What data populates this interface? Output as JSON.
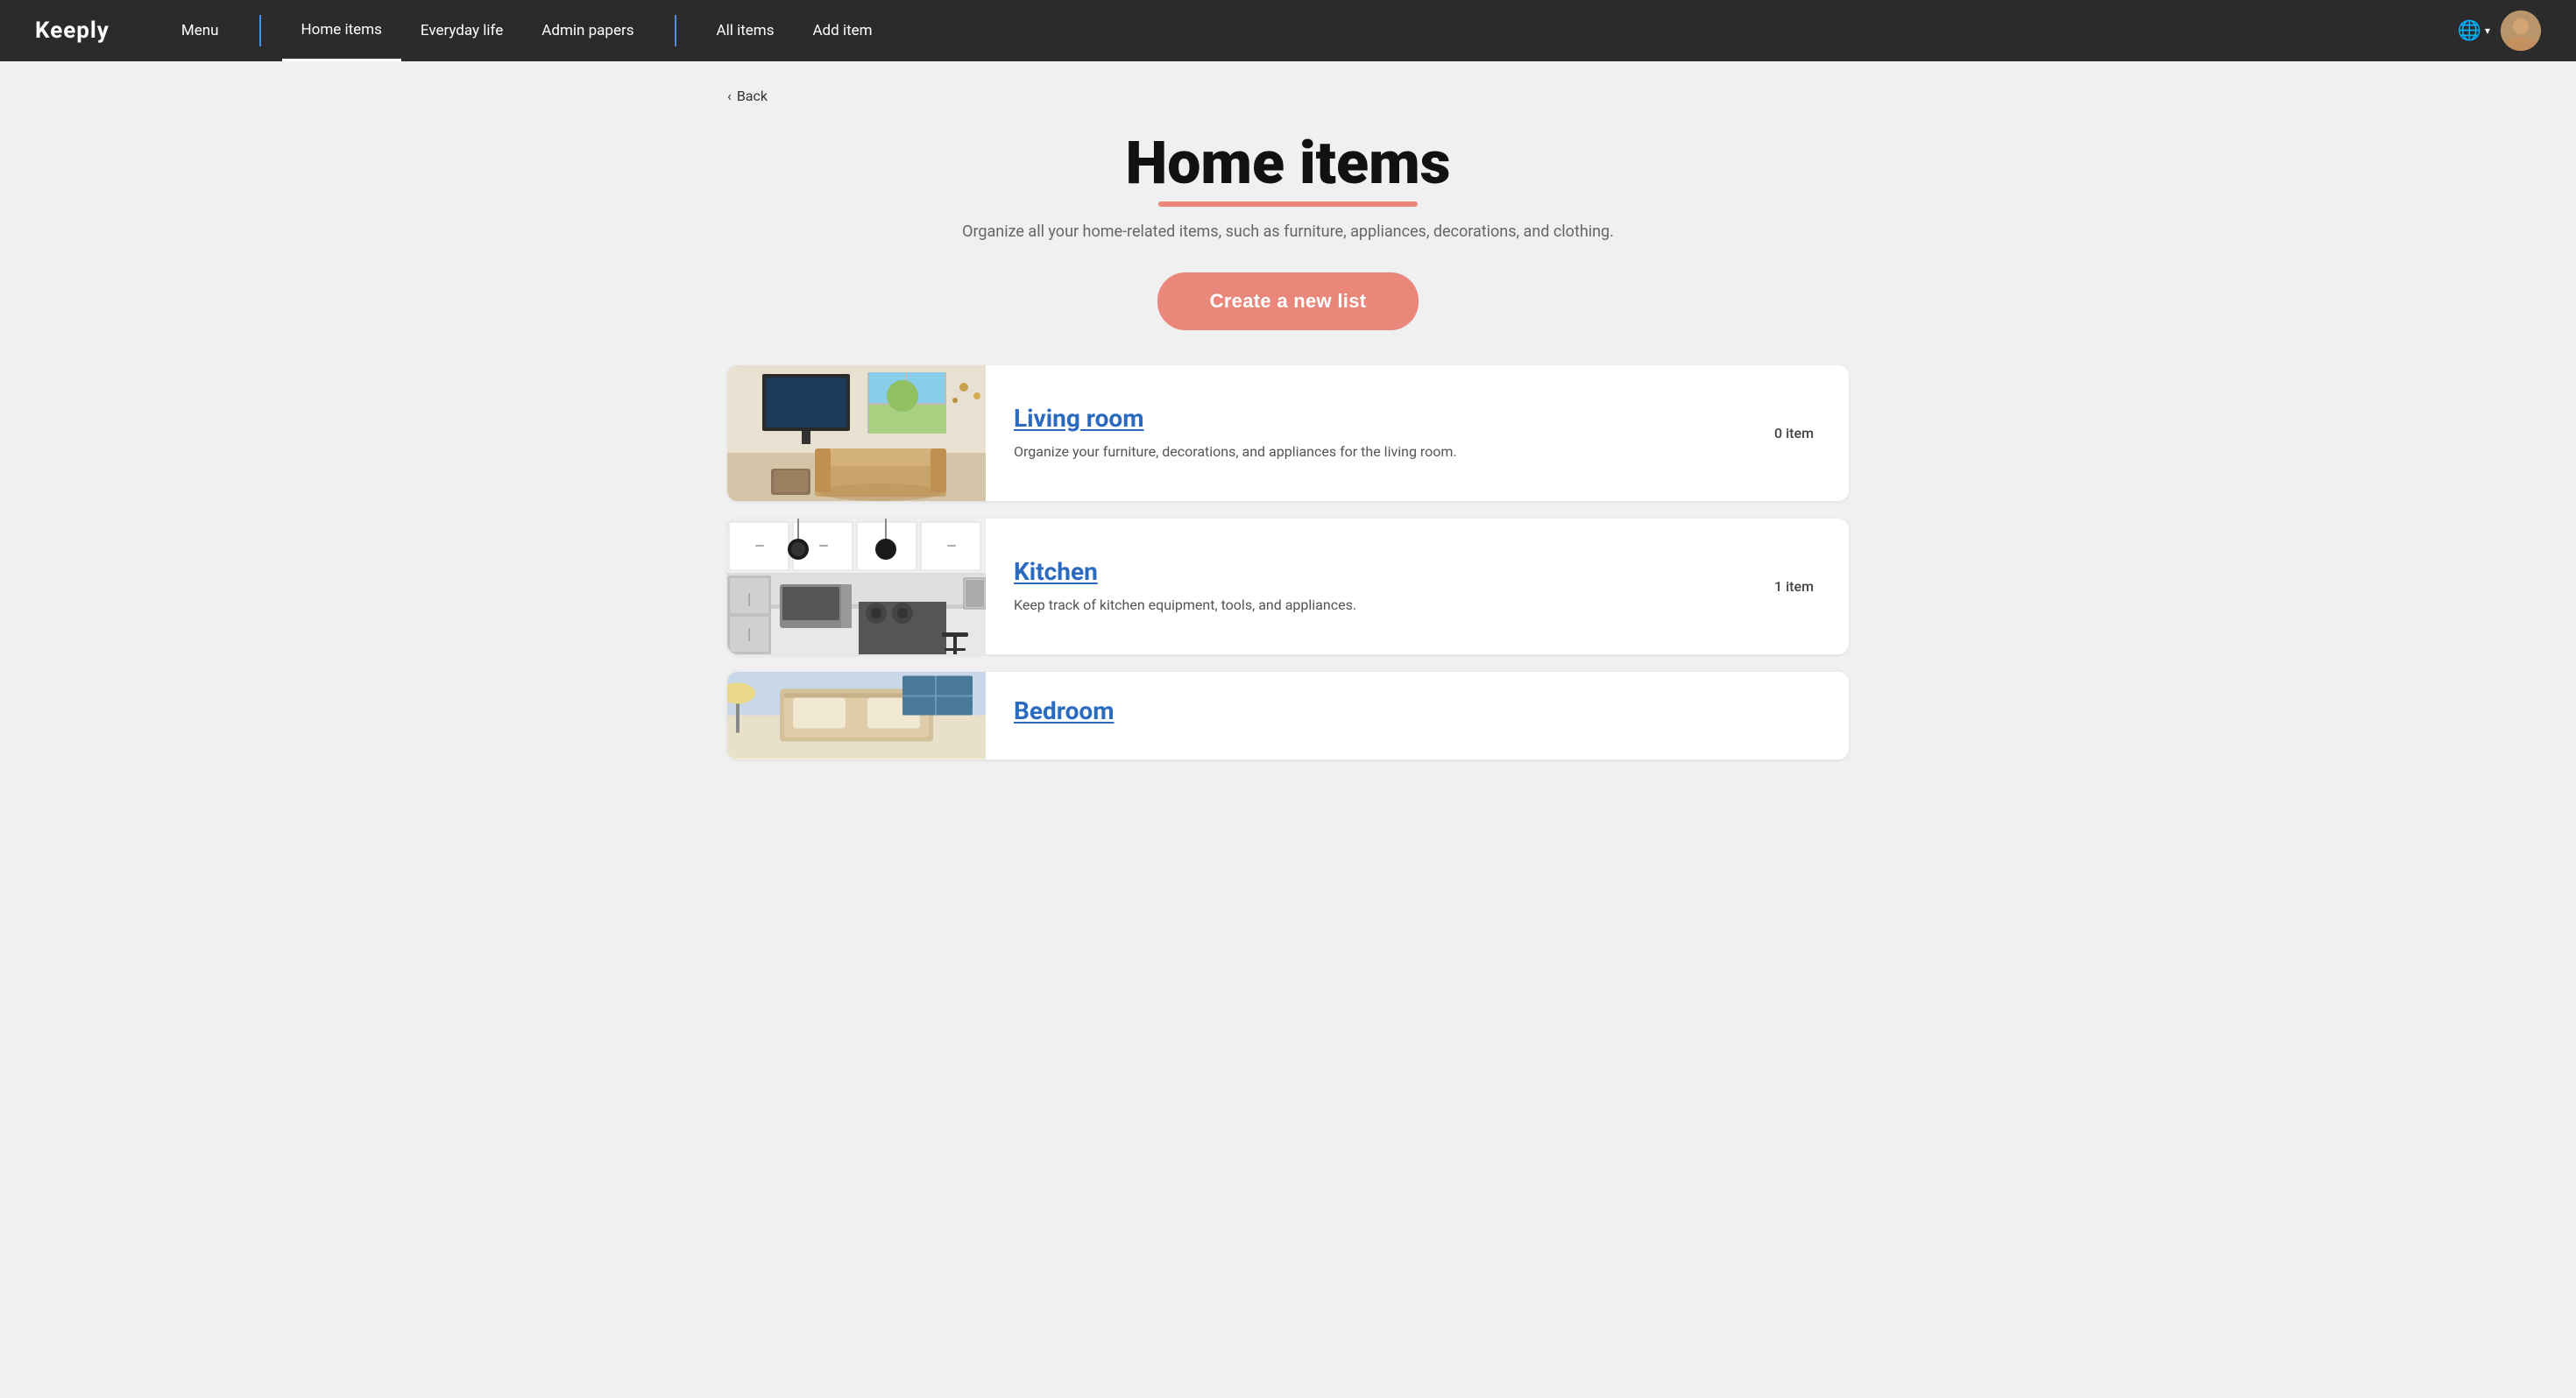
{
  "brand": {
    "logo": "Keeply"
  },
  "navbar": {
    "links": [
      {
        "id": "menu",
        "label": "Menu",
        "active": false
      },
      {
        "id": "home-items",
        "label": "Home items",
        "active": true
      },
      {
        "id": "everyday-life",
        "label": "Everyday life",
        "active": false
      },
      {
        "id": "admin-papers",
        "label": "Admin papers",
        "active": false
      },
      {
        "id": "all-items",
        "label": "All items",
        "active": false
      },
      {
        "id": "add-item",
        "label": "Add item",
        "active": false
      }
    ],
    "back_label": "Back",
    "globe_icon": "🌐"
  },
  "page": {
    "title": "Home items",
    "subtitle": "Organize all your home-related items, such as furniture, appliances, decorations, and clothing.",
    "create_button": "Create a new list"
  },
  "lists": [
    {
      "id": "living-room",
      "title": "Living room",
      "description": "Organize your furniture, decorations, and appliances for the living room.",
      "count": "0 item",
      "image_type": "living-room"
    },
    {
      "id": "kitchen",
      "title": "Kitchen",
      "description": "Keep track of kitchen equipment, tools, and appliances.",
      "count": "1 item",
      "image_type": "kitchen"
    },
    {
      "id": "bedroom",
      "title": "Bedroom",
      "description": "",
      "count": "",
      "image_type": "bedroom"
    }
  ]
}
